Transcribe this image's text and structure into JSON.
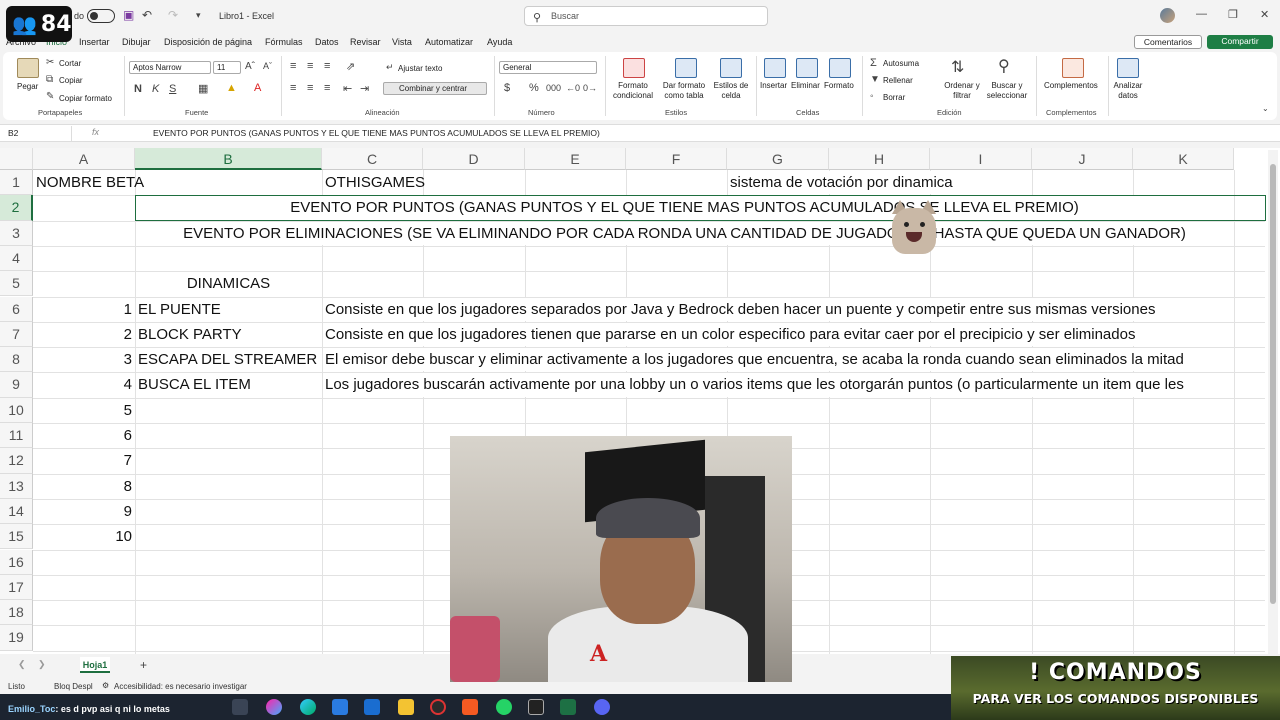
{
  "stream": {
    "viewer_count": "84",
    "chat_user": "Emilio_Toc",
    "chat_message": "es d pvp asi q ni lo metas",
    "banner_title": "! COMANDOS",
    "banner_subtitle": "PARA VER LOS COMANDOS DISPONIBLES"
  },
  "titlebar": {
    "autosave_label": "do",
    "document_title": "Libro1 - Excel",
    "search_placeholder": "Buscar"
  },
  "menu": {
    "tabs": [
      "Archivo",
      "Inicio",
      "Insertar",
      "Dibujar",
      "Disposición de página",
      "Fórmulas",
      "Datos",
      "Revisar",
      "Vista",
      "Automatizar",
      "Ayuda"
    ],
    "comments_label": "Comentarios",
    "share_label": "Compartir"
  },
  "ribbon": {
    "clipboard": {
      "paste": "Pegar",
      "cut": "Cortar",
      "copy": "Copiar",
      "format_painter": "Copiar formato",
      "group": "Portapapeles"
    },
    "font": {
      "name": "Aptos Narrow",
      "size": "11",
      "group": "Fuente"
    },
    "alignment": {
      "wrap": "Ajustar texto",
      "merge": "Combinar y centrar",
      "group": "Alineación"
    },
    "number": {
      "format": "General",
      "group": "Número"
    },
    "styles": {
      "conditional": "Formato condicional",
      "as_table": "Dar formato como tabla",
      "cell_styles": "Estilos de celda",
      "group": "Estilos"
    },
    "cells": {
      "insert": "Insertar",
      "delete": "Eliminar",
      "format": "Formato",
      "group": "Celdas"
    },
    "editing": {
      "autosum": "Autosuma",
      "fill": "Rellenar",
      "clear": "Borrar",
      "sort": "Ordenar y filtrar",
      "find": "Buscar y seleccionar",
      "group": "Edición"
    },
    "addins": {
      "label": "Complementos",
      "group": "Complementos"
    },
    "analyze": {
      "label": "Analizar datos"
    }
  },
  "formula_bar": {
    "name_box": "B2",
    "fx": "fx",
    "content": "EVENTO POR PUNTOS (GANAS PUNTOS Y EL QUE TIENE MAS PUNTOS ACUMULADOS SE LLEVA EL PREMIO)"
  },
  "sheet": {
    "columns": [
      "A",
      "B",
      "C",
      "D",
      "E",
      "F",
      "G",
      "H",
      "I",
      "J",
      "K"
    ],
    "rows": [
      "1",
      "2",
      "3",
      "4",
      "5",
      "6",
      "7",
      "8",
      "9",
      "10",
      "11",
      "12",
      "13",
      "14",
      "15",
      "16",
      "17",
      "18",
      "19"
    ],
    "cells": {
      "A1": "NOMBRE BETA",
      "C1": "OTHISGAMES",
      "G1": "sistema de votación por dinamica",
      "B2": "EVENTO POR PUNTOS (GANAS PUNTOS Y EL QUE TIENE MAS PUNTOS ACUMULADOS SE LLEVA EL PREMIO)",
      "B3": "EVENTO POR ELIMINACIONES (SE VA ELIMINANDO POR CADA RONDA UNA CANTIDAD DE JUGADORES HASTA QUE QUEDA UN GANADOR)",
      "B5": "DINAMICAS",
      "A6": "1",
      "B6": "EL PUENTE",
      "C6": "Consiste en que los jugadores separados por Java y Bedrock deben hacer un puente y competir entre sus mismas versiones",
      "A7": "2",
      "B7": "BLOCK PARTY",
      "C7": "Consiste en que los jugadores tienen que pararse en un color especifico para evitar caer por el precipicio y ser eliminados",
      "A8": "3",
      "B8": "ESCAPA DEL STREAMER",
      "C8": "El emisor debe buscar y eliminar activamente a los jugadores que encuentra, se acaba la ronda cuando sean eliminados la mitad",
      "A9": "4",
      "B9": "BUSCA EL ITEM",
      "C9": "Los jugadores buscarán activamente por una lobby un o varios items que les otorgarán puntos (o particularmente un item que les",
      "A10": "5",
      "A11": "6",
      "A12": "7",
      "A13": "8",
      "A14": "9",
      "A15": "10"
    },
    "active_cell": "B2",
    "sheet_tab": "Hoja1"
  },
  "status": {
    "ready": "Listo",
    "scroll_lock": "Bloq Despl",
    "accessibility": "Accesibilidad: es necesario investigar"
  }
}
